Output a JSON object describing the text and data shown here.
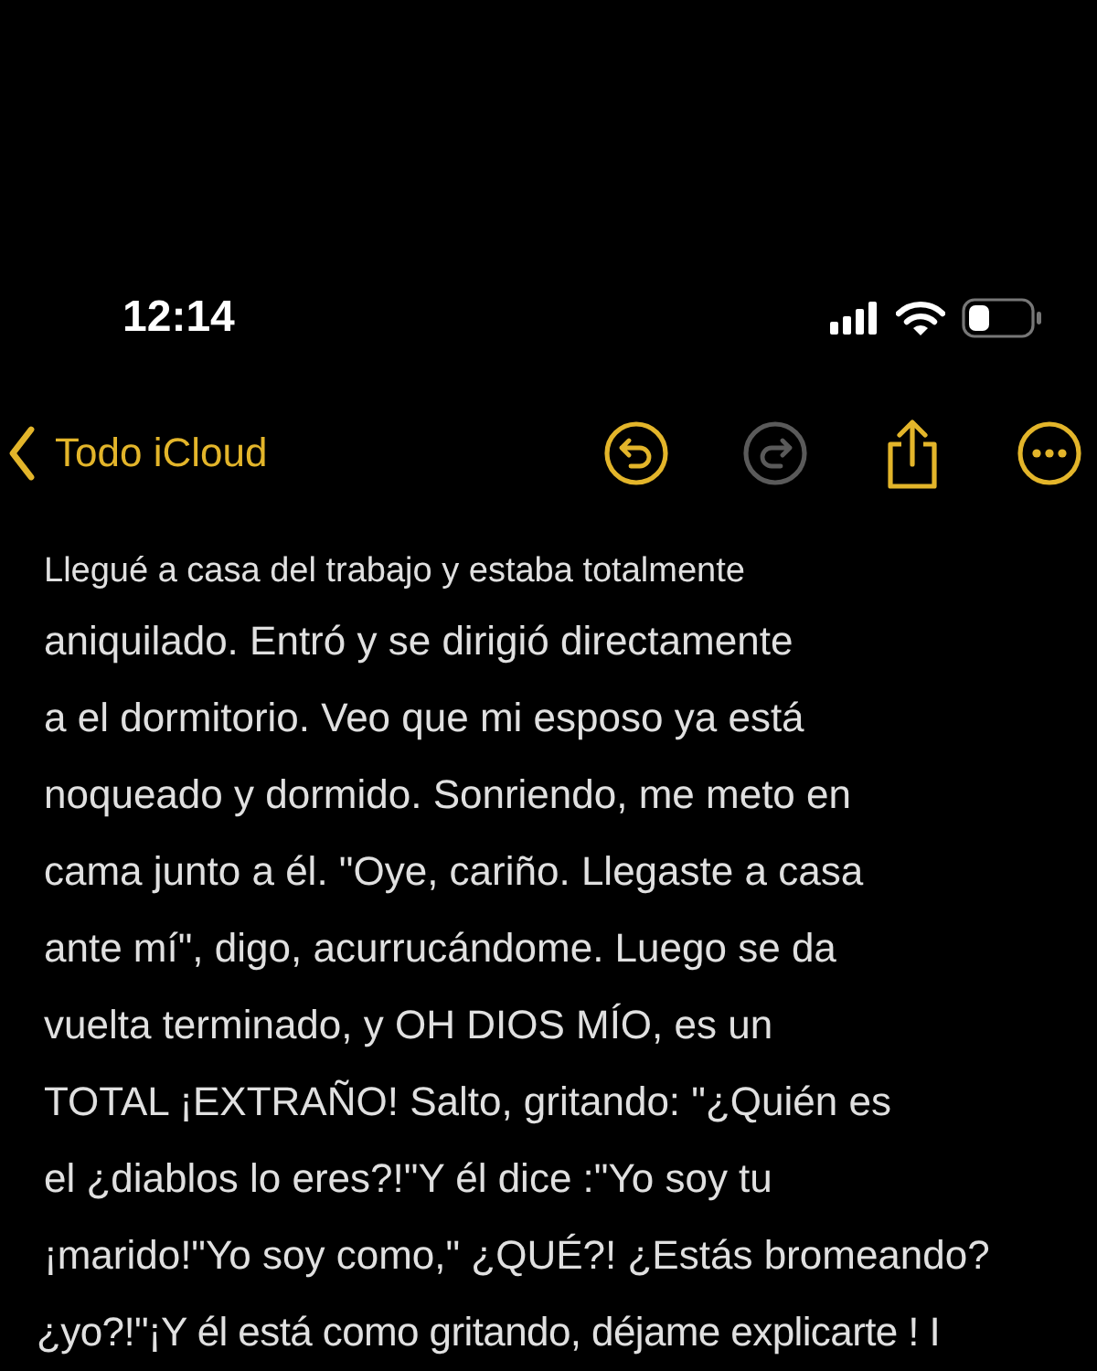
{
  "status_bar": {
    "time": "12:14"
  },
  "nav": {
    "back": {
      "label": "Todo iCloud"
    },
    "tools": [
      {
        "kind": "undo",
        "disabled": false
      },
      {
        "kind": "redo",
        "disabled": true
      },
      {
        "kind": "share",
        "disabled": false
      },
      {
        "kind": "more",
        "disabled": false
      }
    ]
  },
  "note": {
    "lines": [
      "Llegué a casa del trabajo y estaba totalmente",
      "aniquilado. Entró y se dirigió directamente",
      "a el dormitorio. Veo que mi esposo ya está",
      "noqueado y dormido. Sonriendo, me meto en",
      "cama junto a él. \"Oye, cariño. Llegaste a casa",
      "ante mí\", digo, acurrucándome. Luego se da",
      "vuelta terminado, y OH DIOS MÍO, es un",
      "TOTAL ¡EXTRAÑO! Salto, gritando: \"¿Quién es",
      "el ¿diablos lo eres?!\"Y él dice :\"Yo soy tu",
      "¡marido!\"Yo soy como,\" ¿QUÉ?! ¿Estás bromeando?",
      "¿yo?!\"¡Y él está como gritando, déjame explicarte ! I"
    ]
  }
}
